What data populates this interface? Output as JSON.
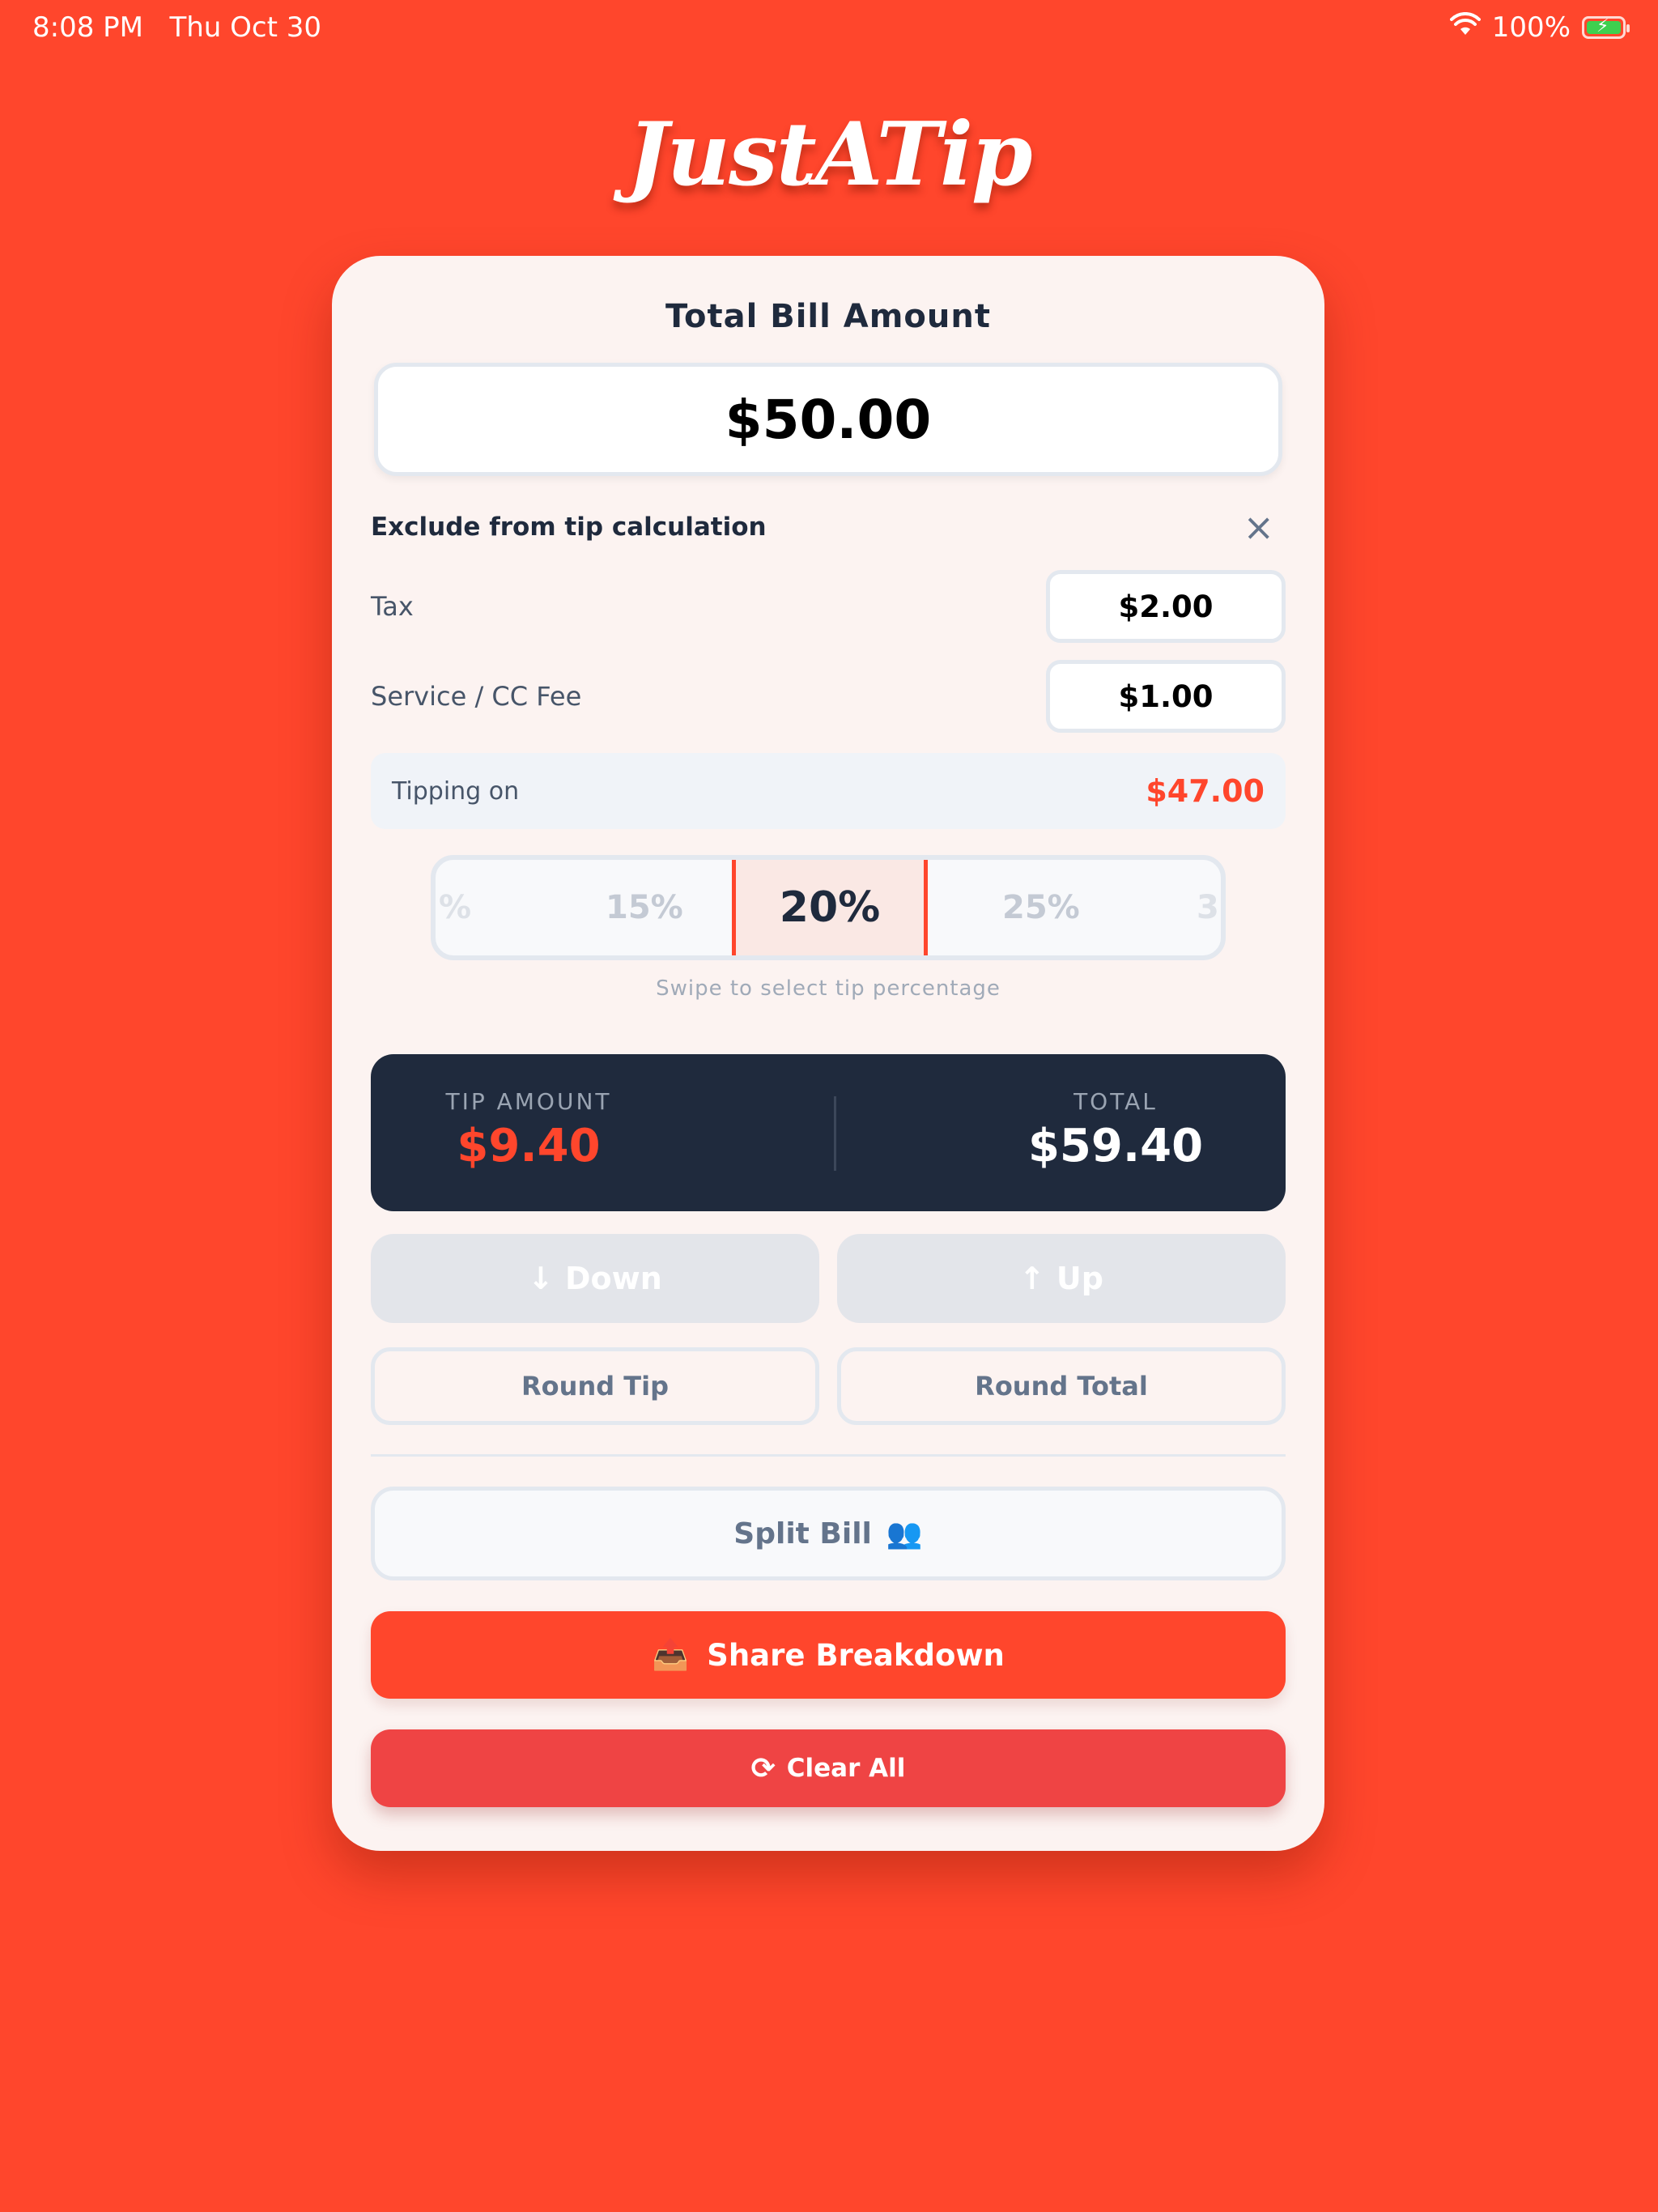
{
  "status_bar": {
    "time": "8:08 PM",
    "date": "Thu Oct 30",
    "battery": "100%"
  },
  "app": {
    "logo_text": "JustATip"
  },
  "bill": {
    "title": "Total Bill Amount",
    "amount": "$50.00"
  },
  "exclude": {
    "heading": "Exclude from tip calculation",
    "close_icon": "×",
    "rows": [
      {
        "label": "Tax",
        "value": "$2.00"
      },
      {
        "label": "Service / CC Fee",
        "value": "$1.00"
      }
    ]
  },
  "tipping": {
    "label": "Tipping on",
    "value": "$47.00"
  },
  "tip_picker": {
    "options": [
      "%",
      "15%",
      "20%",
      "25%",
      "3"
    ],
    "selected": "20%",
    "hint": "Swipe to select tip percentage"
  },
  "summary": {
    "tip_label": "TIP AMOUNT",
    "tip_value": "$9.40",
    "total_label": "TOTAL",
    "total_value": "$59.40"
  },
  "adjust": {
    "down_label": "Down",
    "up_label": "Up",
    "down_icon": "↓",
    "up_icon": "↑"
  },
  "rounding": {
    "round_tip": "Round Tip",
    "round_total": "Round Total"
  },
  "actions": {
    "split_label": "Split Bill",
    "split_icon": "👥",
    "share_label": "Share Breakdown",
    "share_icon": "📤",
    "clear_label": "Clear All",
    "clear_icon": "⟳"
  },
  "colors": {
    "accent": "#ff462c",
    "dark": "#1f2a3d",
    "danger": "#ef4444",
    "card": "#fcf3f1"
  }
}
